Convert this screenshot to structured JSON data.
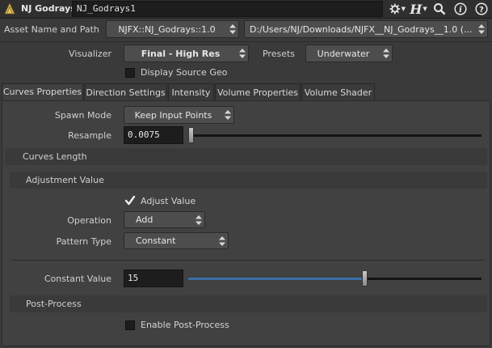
{
  "header": {
    "node_type": "NJ Godrays",
    "node_name": "NJ_Godrays1",
    "icons": [
      "gear-icon",
      "houdini-h-icon",
      "search-icon",
      "info-icon",
      "help-icon"
    ]
  },
  "asset": {
    "label": "Asset Name and Path",
    "name": "NJFX::NJ_Godrays::1.0",
    "path": "D:/Users/NJ/Downloads/NJFX__NJ_Godrays__1.0 (..."
  },
  "visualizer": {
    "label": "Visualizer",
    "value": "Final - High Res",
    "presets_label": "Presets",
    "presets_value": "Underwater",
    "display_source_geo": "Display Source Geo"
  },
  "tabs": [
    {
      "label": "Curves Properties"
    },
    {
      "label": "Direction Settings"
    },
    {
      "label": "Intensity"
    },
    {
      "label": "Volume Properties"
    },
    {
      "label": "Volume Shader"
    }
  ],
  "curves": {
    "spawn_mode_label": "Spawn Mode",
    "spawn_mode_value": "Keep Input Points",
    "resample_label": "Resample",
    "resample_value": "0.0075",
    "curves_length": "Curves Length",
    "adjustment_value": "Adjustment Value",
    "adjust_value_label": "Adjust Value",
    "adjust_value_checked": true,
    "operation_label": "Operation",
    "operation_value": "Add",
    "pattern_type_label": "Pattern Type",
    "pattern_type_value": "Constant",
    "constant_value_label": "Constant Value",
    "constant_value": "15",
    "post_process": "Post-Process",
    "enable_post_process": "Enable Post-Process",
    "enable_post_process_checked": false
  },
  "colors": {
    "accent_fill": "#3a6ea8",
    "background": "#414141",
    "field_bg": "#1d1d1d"
  }
}
